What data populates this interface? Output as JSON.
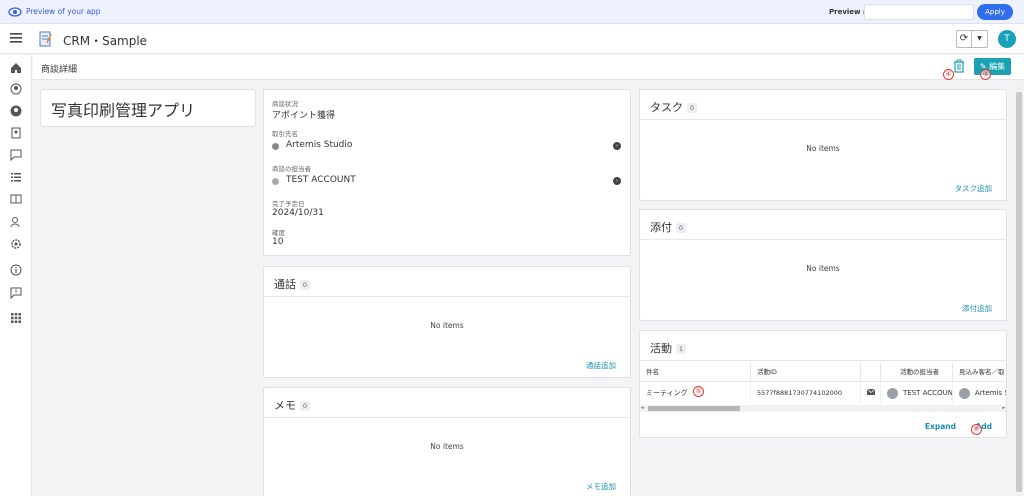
{
  "preview": {
    "label": "Preview of your app",
    "preview_as_label": "Preview as:",
    "preview_as_value": "",
    "apply_label": "Apply"
  },
  "header": {
    "app_title": "CRM・Sample",
    "user_initial": "T"
  },
  "page": {
    "title": "商談詳細",
    "edit_label": "編集"
  },
  "markers": {
    "m4": "④",
    "m3": "③",
    "m5": "⑤",
    "m6": "⑥"
  },
  "title_card": {
    "title": "写真印刷管理アプリ"
  },
  "detail": {
    "status_label": "商談状況",
    "status_value": "アポイント獲得",
    "client_label": "取引先名",
    "client_value": "Artemis Studio",
    "owner_label": "商談の担当者",
    "owner_value": "TEST ACCOUNT",
    "due_label": "完了予定日",
    "due_value": "2024/10/31",
    "prob_label": "確度",
    "prob_value": "10"
  },
  "calls": {
    "title": "通話",
    "count": "0",
    "empty": "No items",
    "add": "通話追加"
  },
  "memo": {
    "title": "メモ",
    "count": "0",
    "empty": "No items",
    "add": "メモ追加"
  },
  "tasks": {
    "title": "タスク",
    "count": "0",
    "empty": "No items",
    "add": "タスク追加"
  },
  "attachments": {
    "title": "添付",
    "count": "0",
    "empty": "No items",
    "add": "添付追加"
  },
  "activities": {
    "title": "活動",
    "count": "1",
    "columns": [
      "件名",
      "活動ID",
      "",
      "活動の担当者",
      "見込み客名／取"
    ],
    "row": {
      "subject": "ミーティング",
      "id": "5577f8881730774102000",
      "owner": "TEST ACCOUNT",
      "client": "Artemis S"
    },
    "expand": "Expand",
    "add": "Add"
  },
  "colors": {
    "accent": "#1aa2b3",
    "link": "#1a8fb0",
    "marker": "#e53935",
    "apply": "#2f6fed"
  }
}
